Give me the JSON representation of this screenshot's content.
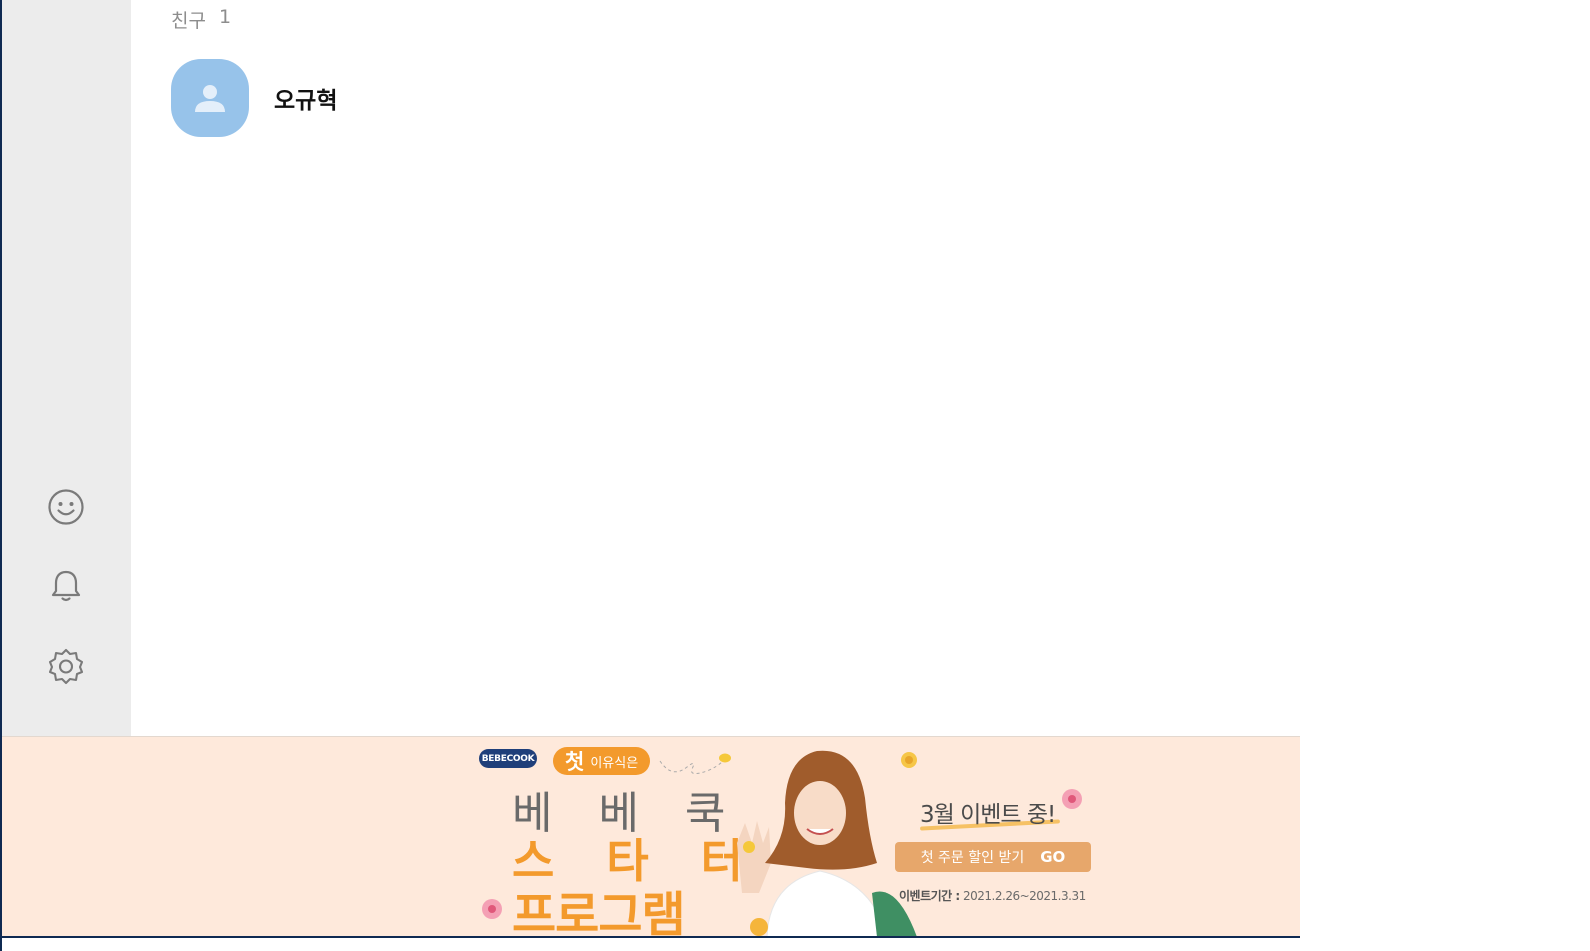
{
  "friends_section": {
    "label": "친구",
    "count": "1",
    "items": [
      {
        "name": "오규혁",
        "avatar_icon": "default-person-icon"
      }
    ]
  },
  "sidebar": {
    "items": [
      {
        "name": "emoticon",
        "icon": "smiley-icon"
      },
      {
        "name": "notifications",
        "icon": "bell-icon"
      },
      {
        "name": "settings",
        "icon": "gear-icon"
      }
    ]
  },
  "ad_banner": {
    "brand": "BEBECOOK",
    "badge_main": "첫",
    "badge_sub": "이유식은",
    "title": "베 베 쿡",
    "headline_line1": "스 타 터",
    "headline_line2": "프로그램",
    "event_title": "3월 이벤트 중!",
    "cta_label": "첫 주문 할인 받기",
    "cta_go": "GO",
    "period_label": "이벤트기간 :",
    "period_value": "2021.2.26~2021.3.31"
  },
  "colors": {
    "sidebar_bg": "#ececec",
    "avatar_bg": "#97c3ea",
    "banner_bg": "#fee9db",
    "accent_orange": "#f39a2c",
    "frame_navy": "#0f2a52"
  }
}
